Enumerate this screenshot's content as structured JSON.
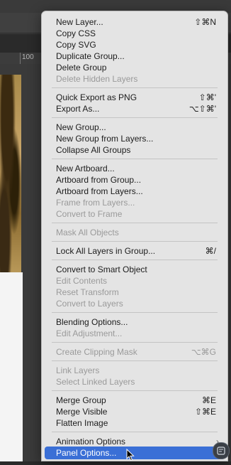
{
  "background": {
    "ruler_label": "100"
  },
  "menu": {
    "groups": [
      [
        {
          "label": "New Layer...",
          "shortcut": "⇧⌘N",
          "enabled": true
        },
        {
          "label": "Copy CSS",
          "shortcut": "",
          "enabled": true
        },
        {
          "label": "Copy SVG",
          "shortcut": "",
          "enabled": true
        },
        {
          "label": "Duplicate Group...",
          "shortcut": "",
          "enabled": true
        },
        {
          "label": "Delete Group",
          "shortcut": "",
          "enabled": true
        },
        {
          "label": "Delete Hidden Layers",
          "shortcut": "",
          "enabled": false
        }
      ],
      [
        {
          "label": "Quick Export as PNG",
          "shortcut": "⇧⌘'",
          "enabled": true
        },
        {
          "label": "Export As...",
          "shortcut": "⌥⇧⌘'",
          "enabled": true
        }
      ],
      [
        {
          "label": "New Group...",
          "shortcut": "",
          "enabled": true
        },
        {
          "label": "New Group from Layers...",
          "shortcut": "",
          "enabled": true
        },
        {
          "label": "Collapse All Groups",
          "shortcut": "",
          "enabled": true
        }
      ],
      [
        {
          "label": "New Artboard...",
          "shortcut": "",
          "enabled": true
        },
        {
          "label": "Artboard from Group...",
          "shortcut": "",
          "enabled": true
        },
        {
          "label": "Artboard from Layers...",
          "shortcut": "",
          "enabled": true
        },
        {
          "label": "Frame from Layers...",
          "shortcut": "",
          "enabled": false
        },
        {
          "label": "Convert to Frame",
          "shortcut": "",
          "enabled": false
        }
      ],
      [
        {
          "label": "Mask All Objects",
          "shortcut": "",
          "enabled": false
        }
      ],
      [
        {
          "label": "Lock All Layers in Group...",
          "shortcut": "⌘/",
          "enabled": true
        }
      ],
      [
        {
          "label": "Convert to Smart Object",
          "shortcut": "",
          "enabled": true
        },
        {
          "label": "Edit Contents",
          "shortcut": "",
          "enabled": false
        },
        {
          "label": "Reset Transform",
          "shortcut": "",
          "enabled": false
        },
        {
          "label": "Convert to Layers",
          "shortcut": "",
          "enabled": false
        }
      ],
      [
        {
          "label": "Blending Options...",
          "shortcut": "",
          "enabled": true
        },
        {
          "label": "Edit Adjustment...",
          "shortcut": "",
          "enabled": false
        }
      ],
      [
        {
          "label": "Create Clipping Mask",
          "shortcut": "⌥⌘G",
          "enabled": false
        }
      ],
      [
        {
          "label": "Link Layers",
          "shortcut": "",
          "enabled": false
        },
        {
          "label": "Select Linked Layers",
          "shortcut": "",
          "enabled": false
        }
      ],
      [
        {
          "label": "Merge Group",
          "shortcut": "⌘E",
          "enabled": true
        },
        {
          "label": "Merge Visible",
          "shortcut": "⇧⌘E",
          "enabled": true
        },
        {
          "label": "Flatten Image",
          "shortcut": "",
          "enabled": true
        }
      ],
      [
        {
          "label": "Animation Options",
          "shortcut": "",
          "enabled": true,
          "submenu": true
        },
        {
          "label": "Panel Options...",
          "shortcut": "",
          "enabled": true,
          "highlighted": true
        }
      ]
    ]
  }
}
